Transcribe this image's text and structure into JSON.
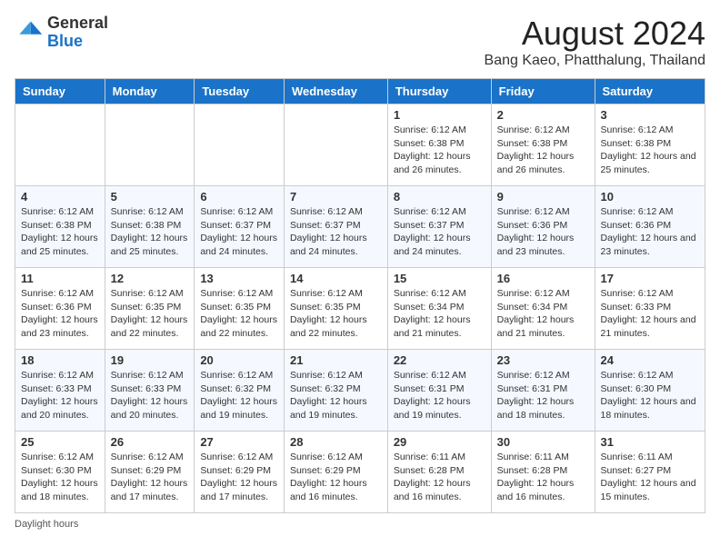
{
  "header": {
    "logo_general": "General",
    "logo_blue": "Blue",
    "month_year": "August 2024",
    "location": "Bang Kaeo, Phatthalung, Thailand"
  },
  "days_of_week": [
    "Sunday",
    "Monday",
    "Tuesday",
    "Wednesday",
    "Thursday",
    "Friday",
    "Saturday"
  ],
  "weeks": [
    [
      {
        "day": "",
        "info": ""
      },
      {
        "day": "",
        "info": ""
      },
      {
        "day": "",
        "info": ""
      },
      {
        "day": "",
        "info": ""
      },
      {
        "day": "1",
        "info": "Sunrise: 6:12 AM\nSunset: 6:38 PM\nDaylight: 12 hours and 26 minutes."
      },
      {
        "day": "2",
        "info": "Sunrise: 6:12 AM\nSunset: 6:38 PM\nDaylight: 12 hours and 26 minutes."
      },
      {
        "day": "3",
        "info": "Sunrise: 6:12 AM\nSunset: 6:38 PM\nDaylight: 12 hours and 25 minutes."
      }
    ],
    [
      {
        "day": "4",
        "info": "Sunrise: 6:12 AM\nSunset: 6:38 PM\nDaylight: 12 hours and 25 minutes."
      },
      {
        "day": "5",
        "info": "Sunrise: 6:12 AM\nSunset: 6:38 PM\nDaylight: 12 hours and 25 minutes."
      },
      {
        "day": "6",
        "info": "Sunrise: 6:12 AM\nSunset: 6:37 PM\nDaylight: 12 hours and 24 minutes."
      },
      {
        "day": "7",
        "info": "Sunrise: 6:12 AM\nSunset: 6:37 PM\nDaylight: 12 hours and 24 minutes."
      },
      {
        "day": "8",
        "info": "Sunrise: 6:12 AM\nSunset: 6:37 PM\nDaylight: 12 hours and 24 minutes."
      },
      {
        "day": "9",
        "info": "Sunrise: 6:12 AM\nSunset: 6:36 PM\nDaylight: 12 hours and 23 minutes."
      },
      {
        "day": "10",
        "info": "Sunrise: 6:12 AM\nSunset: 6:36 PM\nDaylight: 12 hours and 23 minutes."
      }
    ],
    [
      {
        "day": "11",
        "info": "Sunrise: 6:12 AM\nSunset: 6:36 PM\nDaylight: 12 hours and 23 minutes."
      },
      {
        "day": "12",
        "info": "Sunrise: 6:12 AM\nSunset: 6:35 PM\nDaylight: 12 hours and 22 minutes."
      },
      {
        "day": "13",
        "info": "Sunrise: 6:12 AM\nSunset: 6:35 PM\nDaylight: 12 hours and 22 minutes."
      },
      {
        "day": "14",
        "info": "Sunrise: 6:12 AM\nSunset: 6:35 PM\nDaylight: 12 hours and 22 minutes."
      },
      {
        "day": "15",
        "info": "Sunrise: 6:12 AM\nSunset: 6:34 PM\nDaylight: 12 hours and 21 minutes."
      },
      {
        "day": "16",
        "info": "Sunrise: 6:12 AM\nSunset: 6:34 PM\nDaylight: 12 hours and 21 minutes."
      },
      {
        "day": "17",
        "info": "Sunrise: 6:12 AM\nSunset: 6:33 PM\nDaylight: 12 hours and 21 minutes."
      }
    ],
    [
      {
        "day": "18",
        "info": "Sunrise: 6:12 AM\nSunset: 6:33 PM\nDaylight: 12 hours and 20 minutes."
      },
      {
        "day": "19",
        "info": "Sunrise: 6:12 AM\nSunset: 6:33 PM\nDaylight: 12 hours and 20 minutes."
      },
      {
        "day": "20",
        "info": "Sunrise: 6:12 AM\nSunset: 6:32 PM\nDaylight: 12 hours and 19 minutes."
      },
      {
        "day": "21",
        "info": "Sunrise: 6:12 AM\nSunset: 6:32 PM\nDaylight: 12 hours and 19 minutes."
      },
      {
        "day": "22",
        "info": "Sunrise: 6:12 AM\nSunset: 6:31 PM\nDaylight: 12 hours and 19 minutes."
      },
      {
        "day": "23",
        "info": "Sunrise: 6:12 AM\nSunset: 6:31 PM\nDaylight: 12 hours and 18 minutes."
      },
      {
        "day": "24",
        "info": "Sunrise: 6:12 AM\nSunset: 6:30 PM\nDaylight: 12 hours and 18 minutes."
      }
    ],
    [
      {
        "day": "25",
        "info": "Sunrise: 6:12 AM\nSunset: 6:30 PM\nDaylight: 12 hours and 18 minutes."
      },
      {
        "day": "26",
        "info": "Sunrise: 6:12 AM\nSunset: 6:29 PM\nDaylight: 12 hours and 17 minutes."
      },
      {
        "day": "27",
        "info": "Sunrise: 6:12 AM\nSunset: 6:29 PM\nDaylight: 12 hours and 17 minutes."
      },
      {
        "day": "28",
        "info": "Sunrise: 6:12 AM\nSunset: 6:29 PM\nDaylight: 12 hours and 16 minutes."
      },
      {
        "day": "29",
        "info": "Sunrise: 6:11 AM\nSunset: 6:28 PM\nDaylight: 12 hours and 16 minutes."
      },
      {
        "day": "30",
        "info": "Sunrise: 6:11 AM\nSunset: 6:28 PM\nDaylight: 12 hours and 16 minutes."
      },
      {
        "day": "31",
        "info": "Sunrise: 6:11 AM\nSunset: 6:27 PM\nDaylight: 12 hours and 15 minutes."
      }
    ]
  ],
  "footer": {
    "daylight_label": "Daylight hours"
  }
}
